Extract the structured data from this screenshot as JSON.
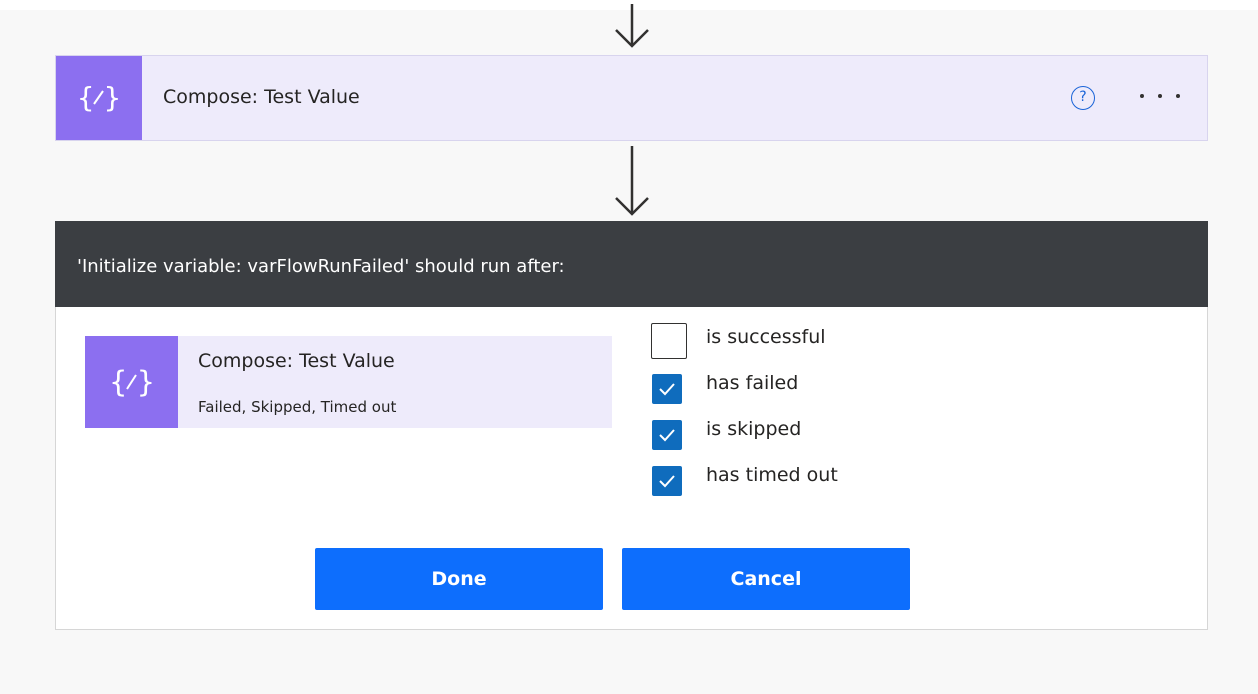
{
  "step": {
    "title": "Compose: Test Value",
    "icon": "compose-braces-icon",
    "help_label": "?",
    "more_icon": "more-options-icon"
  },
  "dialog": {
    "header": "'Initialize variable: varFlowRunFailed' should run after:",
    "action": {
      "title": "Compose: Test Value",
      "status": "Failed, Skipped, Timed out",
      "icon": "compose-braces-icon"
    },
    "options": [
      {
        "label": "is successful",
        "checked": false
      },
      {
        "label": "has failed",
        "checked": true
      },
      {
        "label": "is skipped",
        "checked": true
      },
      {
        "label": "has timed out",
        "checked": true
      }
    ],
    "buttons": {
      "done": "Done",
      "cancel": "Cancel"
    }
  },
  "colors": {
    "accent": "#8c6ff0",
    "card_background": "#eeebfb",
    "header_background": "#3b3e42",
    "primary_button": "#0d6efd",
    "checkbox_checked": "#0f6cbd"
  }
}
